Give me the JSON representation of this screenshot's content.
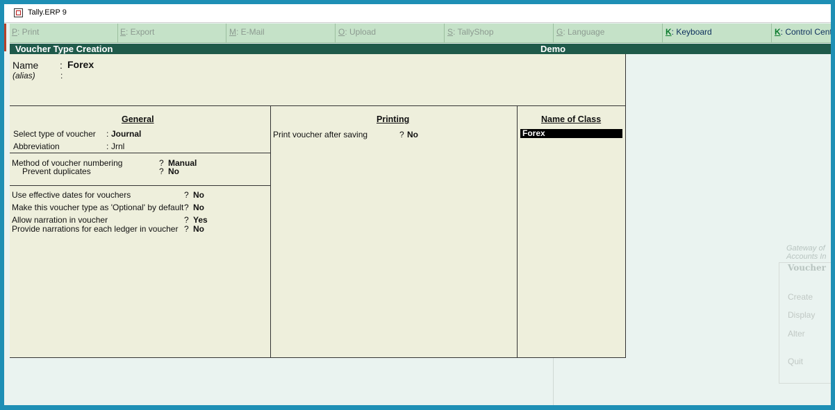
{
  "window": {
    "title": "Tally.ERP 9"
  },
  "buttons": [
    {
      "key": "P",
      "label": ": Print",
      "enabled": false
    },
    {
      "key": "E",
      "label": ": Export",
      "enabled": false
    },
    {
      "key": "M",
      "label": ": E-Mail",
      "enabled": false
    },
    {
      "key": "O",
      "label": ": Upload",
      "enabled": false
    },
    {
      "key": "S",
      "label": ": TallyShop",
      "enabled": false
    },
    {
      "key": "G",
      "label": ": Language",
      "enabled": false
    },
    {
      "key": "K",
      "label": ": Keyboard",
      "enabled": true
    },
    {
      "key": "K",
      "label": ": Control Centre",
      "enabled": true
    }
  ],
  "header": {
    "title": "Voucher Type Creation",
    "company": "Demo"
  },
  "form": {
    "name_label": "Name",
    "name_colon": ":",
    "name_value": "Forex",
    "alias_label": "(alias)",
    "alias_colon": ":"
  },
  "general": {
    "title": "General",
    "select_type_label": "Select type of voucher",
    "select_type_sep": ":",
    "select_type_value": "Journal",
    "abbreviation_label": "Abbreviation",
    "abbreviation_sep": ":",
    "abbreviation_value": "Jrnl",
    "numbering_label": "Method of voucher numbering",
    "numbering_value": "Manual",
    "prevent_dup_label": "Prevent duplicates",
    "prevent_dup_value": "No",
    "effective_dates_label": "Use effective dates for vouchers",
    "effective_dates_value": "No",
    "optional_label": "Make this voucher type as 'Optional' by default",
    "optional_value": "No",
    "narration_label": "Allow narration in voucher",
    "narration_value": "Yes",
    "ledger_narration_label": "Provide narrations for each ledger in voucher",
    "ledger_narration_value": "No",
    "q": "?"
  },
  "printing": {
    "title": "Printing",
    "print_after_label": "Print voucher after saving",
    "print_after_value": "No",
    "q": "?"
  },
  "class": {
    "title": "Name of Class",
    "selected": "Forex"
  },
  "gateway": {
    "line1": "Gateway of",
    "line2": "Accounts In",
    "panel_title": "Voucher",
    "items": [
      "Create",
      "Display",
      "Alter",
      "Quit"
    ]
  }
}
